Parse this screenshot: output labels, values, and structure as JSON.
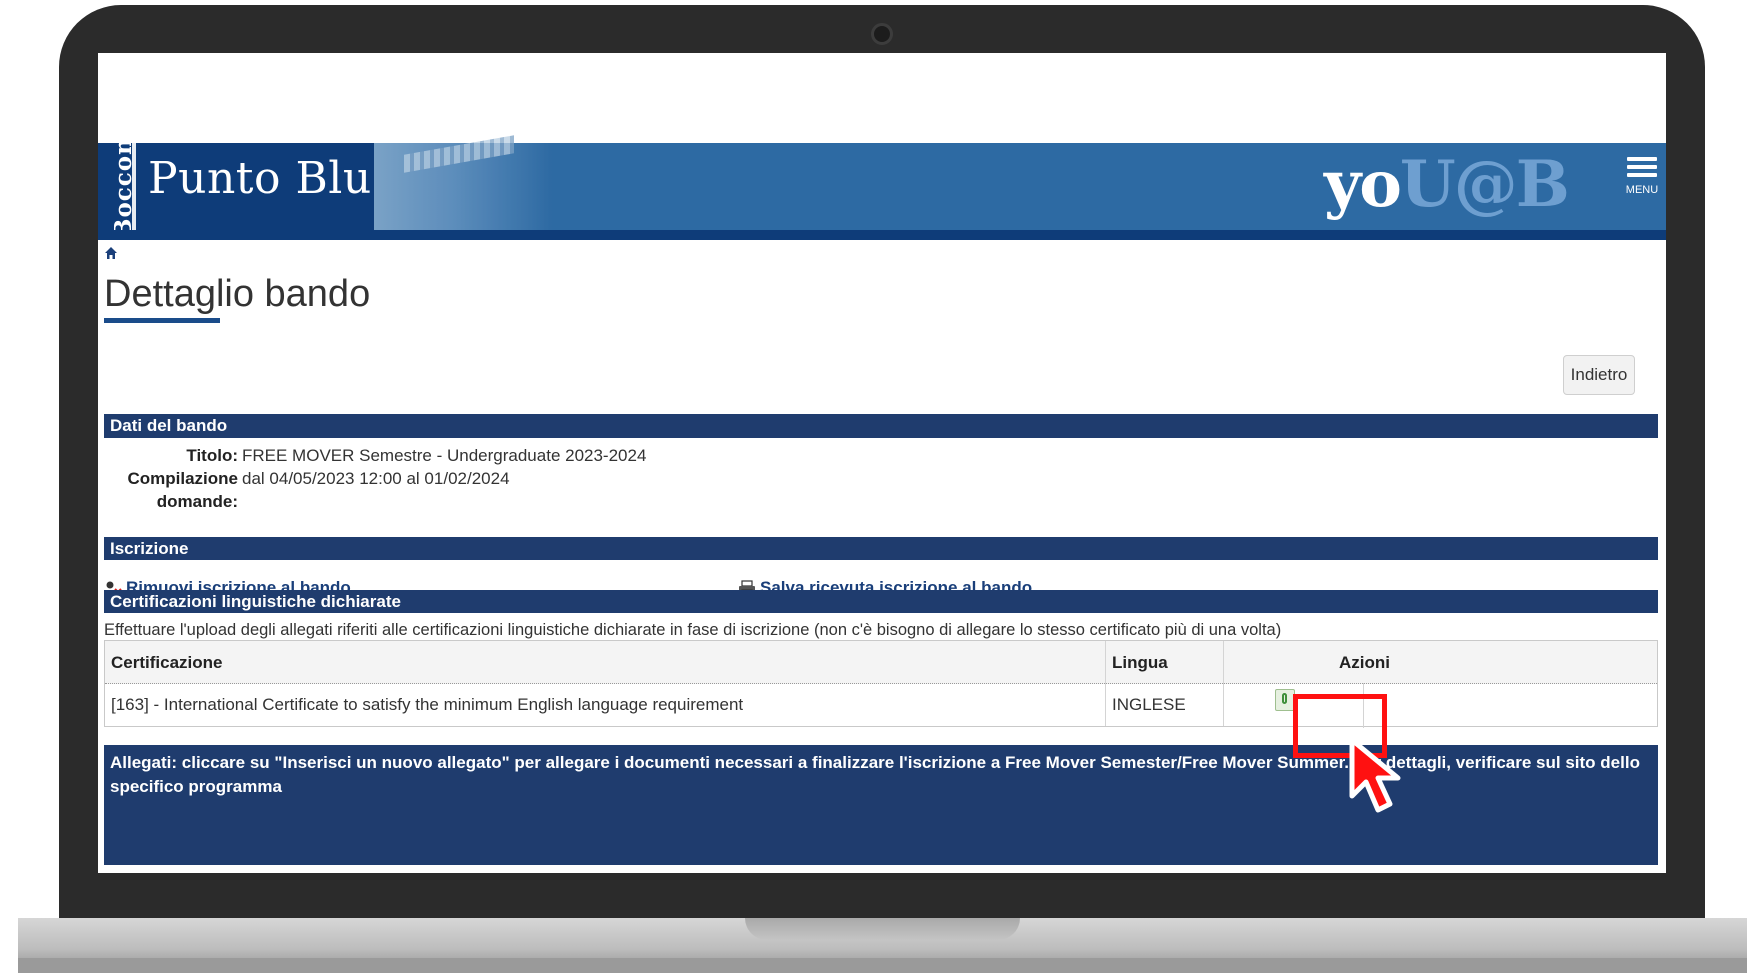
{
  "header": {
    "brand_vertical": "Bocconi",
    "brand_title": "Punto Blu",
    "logo_you": "yo",
    "logo_uab": "U@B",
    "menu_label": "MENU"
  },
  "page": {
    "title": "Dettaglio bando",
    "back_button": "Indietro"
  },
  "dati_bando": {
    "section_title": "Dati del bando",
    "titolo_label": "Titolo:",
    "titolo_value": "FREE MOVER Semestre - Undergraduate 2023-2024",
    "compilazione_label_1": "Compilazione",
    "compilazione_label_2": "domande:",
    "compilazione_value": "dal 04/05/2023 12:00 al 01/02/2024"
  },
  "iscrizione": {
    "section_title": "Iscrizione",
    "remove_link": "Rimuovi iscrizione al bando",
    "save_link": "Salva ricevuta iscrizione al bando"
  },
  "certificazioni": {
    "section_title": "Certificazioni linguistiche dichiarate",
    "note": "Effettuare l'upload degli allegati riferiti alle certificazioni linguistiche dichiarate in fase di iscrizione (non c'è bisogno di allegare lo stesso certificato più di una volta)",
    "columns": [
      "Certificazione",
      "Lingua",
      "Azioni"
    ],
    "rows": [
      {
        "certificazione": "[163] - International Certificate to satisfy the minimum English language requirement",
        "lingua": "INGLESE"
      }
    ]
  },
  "allegati": {
    "text": "Allegati: cliccare su \"Inserisci un nuovo allegato\" per allegare i documenti necessari a finalizzare l'iscrizione a Free Mover Semester/Free Mover Summer. Per dettagli, verificare sul sito dello specifico programma"
  },
  "colors": {
    "banner": "#2d6aa3",
    "banner_dark": "#0e3c79",
    "section_bar": "#1f3c6e",
    "highlight": "#ff1111"
  },
  "icons": [
    "home-icon",
    "hamburger-menu-icon",
    "remove-user-icon",
    "printer-icon",
    "attachment-icon",
    "pointer-cursor-icon"
  ]
}
